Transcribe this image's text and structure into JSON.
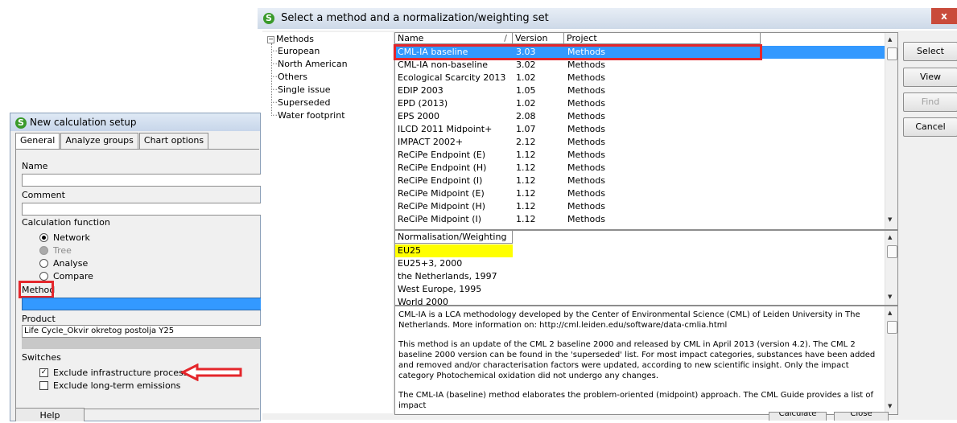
{
  "calc_dialog": {
    "title": "New calculation setup",
    "tabs": [
      "General",
      "Analyze groups",
      "Chart options"
    ],
    "name_label": "Name",
    "name_value": "",
    "comment_label": "Comment",
    "comment_value": "",
    "calc_function_label": "Calculation function",
    "calc_functions": [
      "Network",
      "Tree",
      "Analyse",
      "Compare"
    ],
    "method_label": "Method",
    "method_value": "",
    "product_label": "Product",
    "product_value": "Life Cycle_Okvir okretog postolja Y25",
    "switches_label": "Switches",
    "switch_infra": "Exclude infrastructure processes",
    "switch_longterm": "Exclude long-term emissions",
    "help_label": "Help"
  },
  "select_dialog": {
    "title": "Select a method and a normalization/weighting set",
    "close_glyph": "x",
    "tree_root": "Methods",
    "tree_items": [
      "European",
      "North American",
      "Others",
      "Single issue",
      "Superseded",
      "Water footprint"
    ],
    "columns": [
      "Name",
      "Version",
      "Project"
    ],
    "sort_glyph": "/",
    "methods": [
      {
        "name": "CML-IA baseline",
        "version": "3.03",
        "project": "Methods"
      },
      {
        "name": "CML-IA non-baseline",
        "version": "3.02",
        "project": "Methods"
      },
      {
        "name": "Ecological Scarcity 2013",
        "version": "1.02",
        "project": "Methods"
      },
      {
        "name": "EDIP 2003",
        "version": "1.05",
        "project": "Methods"
      },
      {
        "name": "EPD (2013)",
        "version": "1.02",
        "project": "Methods"
      },
      {
        "name": "EPS 2000",
        "version": "2.08",
        "project": "Methods"
      },
      {
        "name": "ILCD 2011 Midpoint+",
        "version": "1.07",
        "project": "Methods"
      },
      {
        "name": "IMPACT 2002+",
        "version": "2.12",
        "project": "Methods"
      },
      {
        "name": "ReCiPe Endpoint (E)",
        "version": "1.12",
        "project": "Methods"
      },
      {
        "name": "ReCiPe Endpoint (H)",
        "version": "1.12",
        "project": "Methods"
      },
      {
        "name": "ReCiPe Endpoint (I)",
        "version": "1.12",
        "project": "Methods"
      },
      {
        "name": "ReCiPe Midpoint (E)",
        "version": "1.12",
        "project": "Methods"
      },
      {
        "name": "ReCiPe Midpoint (H)",
        "version": "1.12",
        "project": "Methods"
      },
      {
        "name": "ReCiPe Midpoint (I)",
        "version": "1.12",
        "project": "Methods"
      }
    ],
    "norm_header": "Normalisation/Weighting set",
    "norm_sets": [
      "EU25",
      "EU25+3, 2000",
      "the Netherlands, 1997",
      "West Europe, 1995",
      "World 2000"
    ],
    "description": [
      "CML-IA is a LCA methodology developed by the Center of Environmental Science (CML) of Leiden University in The Netherlands. More information on:  http://cml.leiden.edu/software/data-cmlia.html",
      "This method is an update of the CML 2 baseline 2000 and released by CML in April 2013 (version 4.2). The CML 2 baseline 2000 version can be found in the 'superseded' list. For most impact categories, substances have been added and removed and/or characterisation factors were updated, according to new scientific insight. Only the impact category Photochemical oxidation did not undergo any changes.",
      "The CML-IA (baseline) method elaborates the problem-oriented (midpoint) approach. The CML Guide provides a list of impact"
    ],
    "buttons": {
      "select": "Select",
      "view": "View",
      "find": "Find",
      "cancel": "Cancel"
    },
    "bottom_buttons": {
      "calculate": "Calculate",
      "close": "Close"
    }
  },
  "colors": {
    "selection": "#3399ff",
    "highlight_yellow": "#ffff00",
    "annotation_red": "#e4262b"
  }
}
